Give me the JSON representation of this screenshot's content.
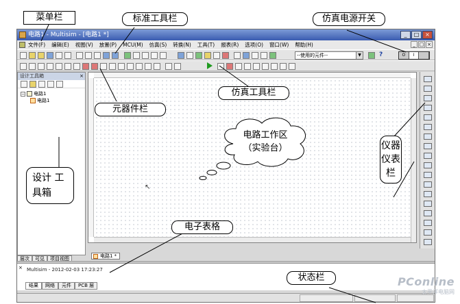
{
  "window": {
    "title": "电路1 - Multisim - [电路1 *]",
    "controls": [
      "_",
      "□",
      "×"
    ],
    "mdi_controls": [
      "_",
      "□",
      "×"
    ]
  },
  "menubar": {
    "items": [
      "文件(F)",
      "编辑(E)",
      "视图(V)",
      "放置(P)",
      "MCU(M)",
      "仿真(S)",
      "转换(N)",
      "工具(T)",
      "报表(R)",
      "选项(O)",
      "窗口(W)",
      "帮助(H)"
    ]
  },
  "toolbar": {
    "in_use_list": "--使用的元件--",
    "help_symbol": "?",
    "power_switch": {
      "off_label": "O",
      "on_label": "I"
    }
  },
  "design_toolbox": {
    "title": "设计工具箱",
    "close_label": "×",
    "tree": [
      {
        "label": "电路1",
        "level": 0
      },
      {
        "label": "电路1",
        "level": 1
      }
    ],
    "tabs": [
      "层次",
      "可见",
      "项目视图"
    ]
  },
  "workspace": {
    "sheet_tab": "电路1 *"
  },
  "spreadsheet": {
    "log_entry": "Multisim  -  2012-02-03 17:23:27",
    "tabs": [
      "结果",
      "网络",
      "元件",
      "PCB 层"
    ]
  },
  "annotations": {
    "menu_bar": "菜单栏",
    "standard_toolbar": "标准工具栏",
    "power_switch": "仿真电源开关",
    "component_toolbar": "元器件栏",
    "simulation_toolbar": "仿真工具栏",
    "workspace_line1": "电路工作区",
    "workspace_line2": "（实验台）",
    "design_toolbox_line1": "设计 工",
    "design_toolbox_line2": "具箱",
    "instrument_toolbar": "仪器仪表栏",
    "spreadsheet": "电子表格",
    "status_bar": "状态栏"
  },
  "watermark": {
    "main": "PConline",
    "sub": "太平洋电脑网"
  }
}
